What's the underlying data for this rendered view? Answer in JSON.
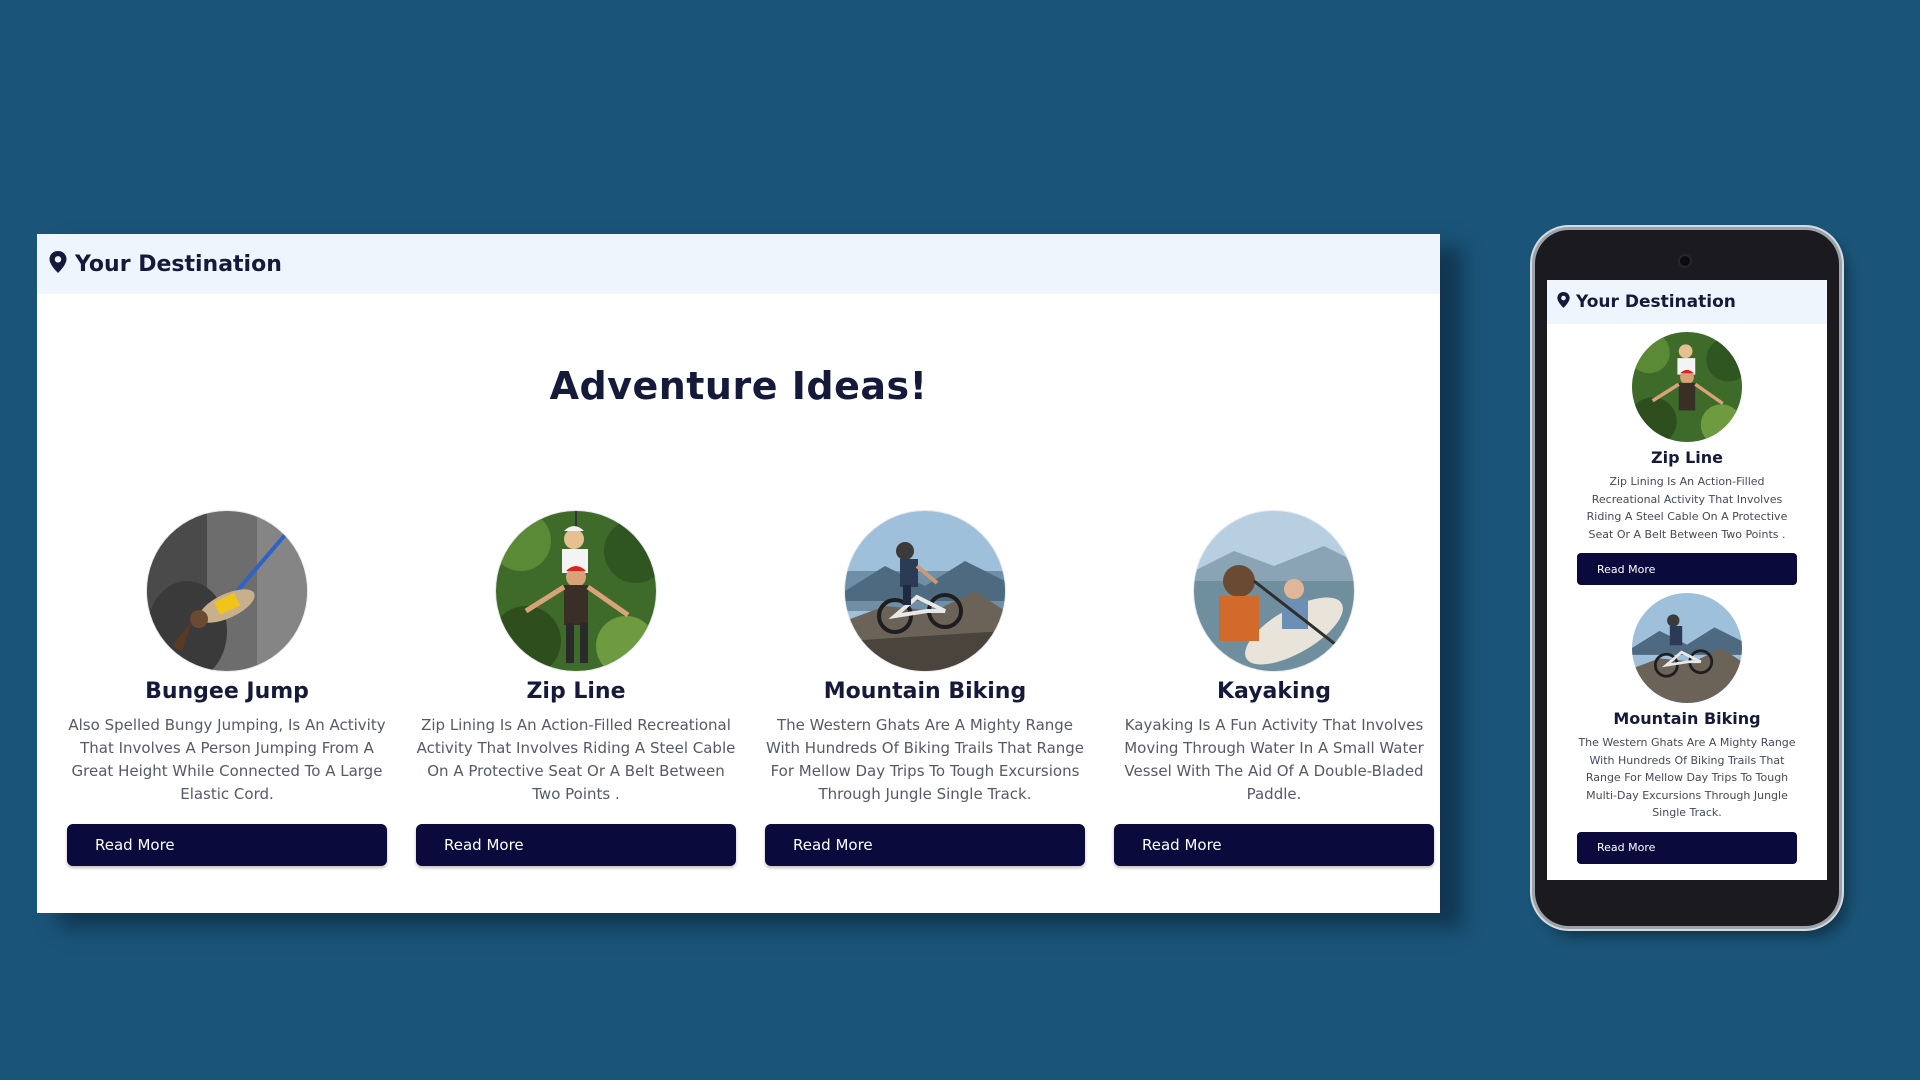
{
  "brand": {
    "name": "Your Destination",
    "icon": "map-pin-icon"
  },
  "hero": {
    "title": "Adventure Ideas!"
  },
  "cards": [
    {
      "title": "Bungee Jump",
      "description": "Also Spelled Bungy Jumping, Is An Activity That Involves A Person Jumping From A Great Height While Connected To A Large Elastic Cord.",
      "button": "Read More"
    },
    {
      "title": "Zip Line",
      "description": "Zip Lining Is An Action-Filled Recreational Activity That Involves Riding A Steel Cable On A Protective Seat Or A Belt Between Two Points .",
      "button": "Read More"
    },
    {
      "title": "Mountain Biking",
      "description": "The Western Ghats Are A Mighty Range With Hundreds Of Biking Trails That Range For Mellow Day Trips To Tough Excursions Through Jungle Single Track.",
      "button": "Read More"
    },
    {
      "title": "Kayaking",
      "description": "Kayaking Is A Fun Activity That Involves Moving Through Water In A Small Water Vessel With The Aid Of A Double-Bladed Paddle.",
      "button": "Read More"
    }
  ],
  "mobile": {
    "cards": [
      {
        "title": "Zip Line",
        "description": "Zip Lining Is An Action-Filled Recreational Activity That Involves Riding A Steel Cable On A Protective Seat Or A Belt Between Two Points .",
        "button": "Read More"
      },
      {
        "title": "Mountain Biking",
        "description": "The Western Ghats Are A Mighty Range With Hundreds Of Biking Trails That Range For Mellow Day Trips To Tough Multi-Day Excursions Through Jungle Single Track.",
        "button": "Read More"
      }
    ]
  },
  "colors": {
    "background": "#1a5478",
    "header": "#eef5fd",
    "button": "#0a0a3c",
    "heading": "#161a3a"
  }
}
